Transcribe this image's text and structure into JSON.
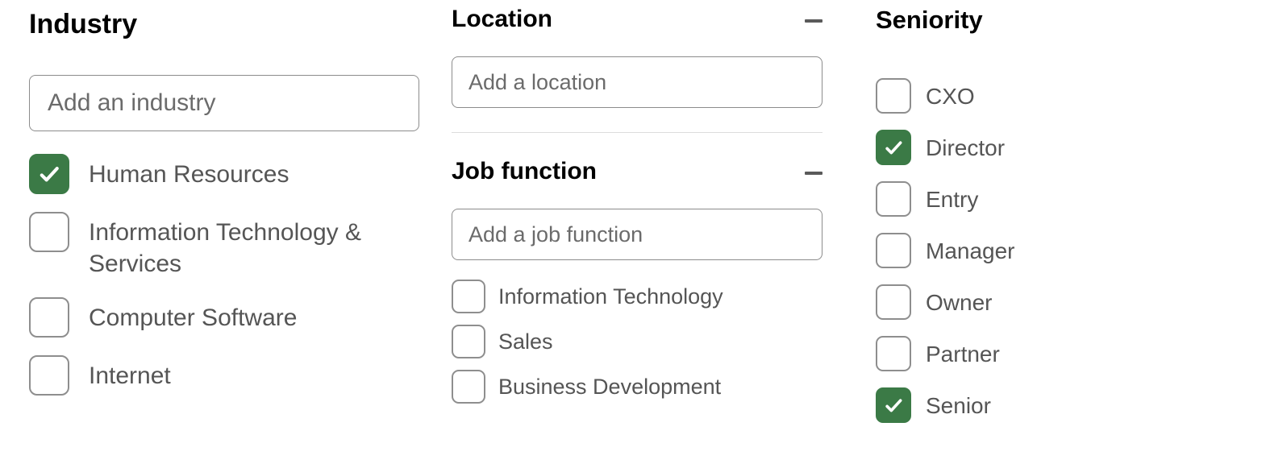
{
  "industry": {
    "title": "Industry",
    "input_placeholder": "Add an industry",
    "options": [
      {
        "label": "Human Resources",
        "checked": true
      },
      {
        "label": "Information Technology & Services",
        "checked": false
      },
      {
        "label": "Computer Software",
        "checked": false
      },
      {
        "label": "Internet",
        "checked": false
      }
    ]
  },
  "location": {
    "title": "Location",
    "input_placeholder": "Add a location",
    "options": []
  },
  "job_function": {
    "title": "Job function",
    "input_placeholder": "Add a job function",
    "options": [
      {
        "label": "Information Technology",
        "checked": false
      },
      {
        "label": "Sales",
        "checked": false
      },
      {
        "label": "Business Development",
        "checked": false
      }
    ]
  },
  "seniority": {
    "title": "Seniority",
    "options": [
      {
        "label": "CXO",
        "checked": false
      },
      {
        "label": "Director",
        "checked": true
      },
      {
        "label": "Entry",
        "checked": false
      },
      {
        "label": "Manager",
        "checked": false
      },
      {
        "label": "Owner",
        "checked": false
      },
      {
        "label": "Partner",
        "checked": false
      },
      {
        "label": "Senior",
        "checked": true
      }
    ]
  }
}
